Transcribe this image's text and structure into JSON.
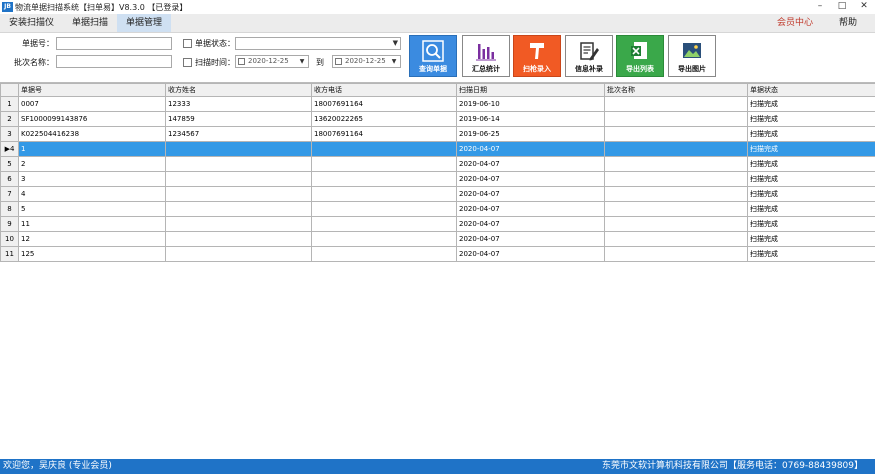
{
  "window": {
    "icon_text": "JB",
    "title": "物流单据扫描系统【扫单易】V8.3.0 【已登录】",
    "min": "–",
    "max": "□",
    "close": "✕"
  },
  "menu": {
    "items": [
      "安装扫描仪",
      "单据扫描",
      "单据管理"
    ],
    "member": "会员中心",
    "help": "帮助"
  },
  "filters": {
    "bill_no_label": "单据号：",
    "batch_label": "批次名称：",
    "status_label": "单据状态：",
    "time_label": "扫描时间：",
    "date_from": "2020-12-25",
    "to_label": "到",
    "date_to": "2020-12-25"
  },
  "buttons": {
    "query": "查询单据",
    "summary": "汇总统计",
    "gun_input": "扫枪录入",
    "info": "信息补录",
    "export_list": "导出列表",
    "export_image": "导出图片"
  },
  "colors": {
    "accent": "#1f73c7",
    "selected_row": "#3399e6",
    "member": "#c0392b"
  },
  "table": {
    "columns": [
      "",
      "单据号",
      "收方姓名",
      "收方电话",
      "扫描日期",
      "批次名称",
      "单据状态"
    ],
    "rows": [
      [
        "1",
        "0007",
        "12333",
        "18007691164",
        "2019-06-10",
        "",
        "扫描完成"
      ],
      [
        "2",
        "SF1000099143876",
        "147859",
        "13620022265",
        "2019-06-14",
        "",
        "扫描完成"
      ],
      [
        "3",
        "K022504416238",
        "1234567",
        "18007691164",
        "2019-06-25",
        "",
        "扫描完成"
      ],
      [
        "▶4",
        "1",
        "",
        "",
        "2020-04-07",
        "",
        "扫描完成"
      ],
      [
        "5",
        "2",
        "",
        "",
        "2020-04-07",
        "",
        "扫描完成"
      ],
      [
        "6",
        "3",
        "",
        "",
        "2020-04-07",
        "",
        "扫描完成"
      ],
      [
        "7",
        "4",
        "",
        "",
        "2020-04-07",
        "",
        "扫描完成"
      ],
      [
        "8",
        "5",
        "",
        "",
        "2020-04-07",
        "",
        "扫描完成"
      ],
      [
        "9",
        "11",
        "",
        "",
        "2020-04-07",
        "",
        "扫描完成"
      ],
      [
        "10",
        "12",
        "",
        "",
        "2020-04-07",
        "",
        "扫描完成"
      ],
      [
        "11",
        "125",
        "",
        "",
        "2020-04-07",
        "",
        "扫描完成"
      ]
    ]
  },
  "status": {
    "left": "欢迎您，吴庆良 (专业会员)",
    "right": "东莞市文软计算机科技有限公司【服务电话：0769-88439809】"
  }
}
